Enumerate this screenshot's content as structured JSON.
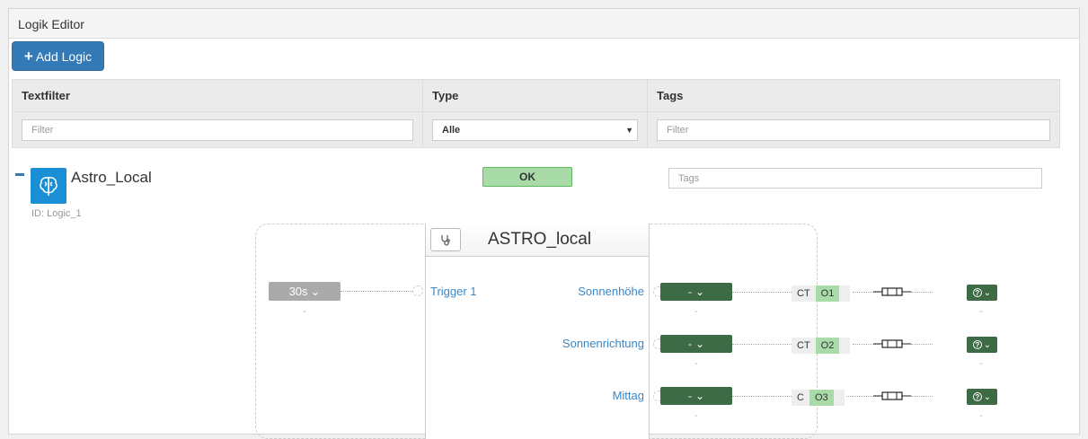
{
  "panel": {
    "title": "Logik Editor"
  },
  "toolbar": {
    "add_label": "Add Logic"
  },
  "filters": {
    "headers": [
      "Textfilter",
      "Type",
      "Tags"
    ],
    "text_placeholder": "Filter",
    "type_value": "Alle",
    "tags_placeholder": "Filter"
  },
  "logic": {
    "name": "Astro_Local",
    "id_text": "ID: Logic_1",
    "status": "OK",
    "tags_placeholder": "Tags",
    "block_title": "ASTRO_local",
    "trigger": {
      "label": "30s",
      "sub": "-"
    },
    "inputs": [
      "Trigger 1"
    ],
    "outputs": [
      {
        "name": "Sonnenhöhe",
        "value": "-",
        "sub": "-",
        "type": "CT",
        "port": "O1"
      },
      {
        "name": "Sonnenrichtung",
        "value": "-",
        "sub": "-",
        "type": "CT",
        "port": "O2"
      },
      {
        "name": "Mittag",
        "value": "-",
        "sub": "-",
        "type": "C",
        "port": "O3"
      }
    ]
  },
  "colors": {
    "primary": "#337ab7",
    "ok_bg": "#a9dba9",
    "output_btn": "#3d6b45"
  }
}
